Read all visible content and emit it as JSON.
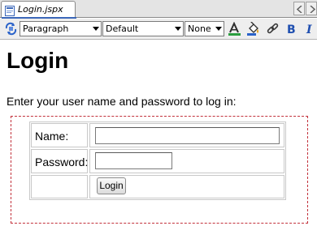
{
  "editor_tab": {
    "label": "Login.jspx"
  },
  "toolbar": {
    "block_format": "Paragraph",
    "font": "Default",
    "size": "None"
  },
  "page": {
    "heading": "Login",
    "instructions": "Enter your user name and password to log in:",
    "form": {
      "name_label": "Name:",
      "name_value": "",
      "password_label": "Password:",
      "password_value": "",
      "login_button": "Login"
    }
  },
  "colors": {
    "form_border": "#c2313b",
    "tab_accent": "#3b67b9",
    "table_border": "#c8c8c8"
  }
}
